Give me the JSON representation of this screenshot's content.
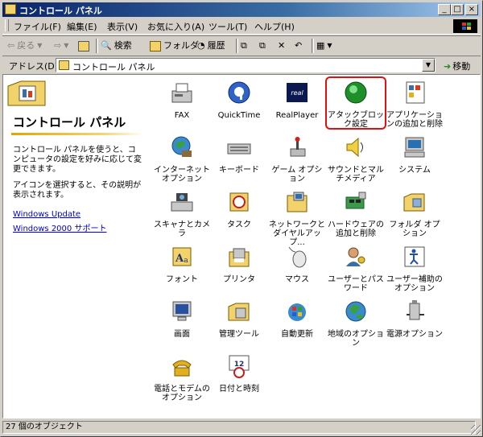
{
  "window": {
    "title": "コントロール パネル"
  },
  "menubar": {
    "items": [
      "ファイル(F)",
      "編集(E)",
      "表示(V)",
      "お気に入り(A)",
      "ツール(T)",
      "ヘルプ(H)"
    ]
  },
  "toolbar": {
    "back": "戻る",
    "search": "検索",
    "folders": "フォルダ",
    "history": "履歴"
  },
  "address": {
    "label": "アドレス(D)",
    "value": "コントロール パネル",
    "go": "移動"
  },
  "left_pane": {
    "title": "コントロール パネル",
    "description": "コントロール パネルを使うと、コンピュータの設定を好みに応じて変更できます。",
    "hint": "アイコンを選択すると、その説明が表示されます。",
    "links": [
      "Windows Update",
      "Windows 2000 サポート"
    ]
  },
  "items": [
    {
      "label": "FAX",
      "icon": "fax-icon"
    },
    {
      "label": "QuickTime",
      "icon": "quicktime-icon"
    },
    {
      "label": "RealPlayer",
      "icon": "realplayer-icon"
    },
    {
      "label": "アタックブロック設定",
      "icon": "attack-block-icon"
    },
    {
      "label": "アプリケーションの追加と削除",
      "icon": "add-remove-programs-icon"
    },
    {
      "label": "インターネット オプション",
      "icon": "internet-options-icon"
    },
    {
      "label": "キーボード",
      "icon": "keyboard-icon"
    },
    {
      "label": "ゲーム オプション",
      "icon": "game-controller-icon"
    },
    {
      "label": "サウンドとマルチメディア",
      "icon": "sound-icon"
    },
    {
      "label": "システム",
      "icon": "system-icon"
    },
    {
      "label": "スキャナとカメラ",
      "icon": "scanner-camera-icon"
    },
    {
      "label": "タスク",
      "icon": "scheduled-tasks-icon"
    },
    {
      "label": "ネットワークとダイヤルアップ...",
      "icon": "network-icon"
    },
    {
      "label": "ハードウェアの追加と削除",
      "icon": "add-hardware-icon"
    },
    {
      "label": "フォルダ オプション",
      "icon": "folder-options-icon"
    },
    {
      "label": "フォント",
      "icon": "fonts-icon"
    },
    {
      "label": "プリンタ",
      "icon": "printer-icon"
    },
    {
      "label": "マウス",
      "icon": "mouse-icon"
    },
    {
      "label": "ユーザーとパスワード",
      "icon": "users-passwords-icon"
    },
    {
      "label": "ユーザー補助のオプション",
      "icon": "accessibility-icon"
    },
    {
      "label": "画面",
      "icon": "display-icon"
    },
    {
      "label": "管理ツール",
      "icon": "admin-tools-icon"
    },
    {
      "label": "自動更新",
      "icon": "auto-update-icon"
    },
    {
      "label": "地域のオプション",
      "icon": "regional-options-icon"
    },
    {
      "label": "電源オプション",
      "icon": "power-options-icon"
    },
    {
      "label": "電話とモデムのオプション",
      "icon": "phone-modem-icon"
    },
    {
      "label": "日付と時刻",
      "icon": "date-time-icon"
    }
  ],
  "status": {
    "text": "27 個のオブジェクト"
  }
}
